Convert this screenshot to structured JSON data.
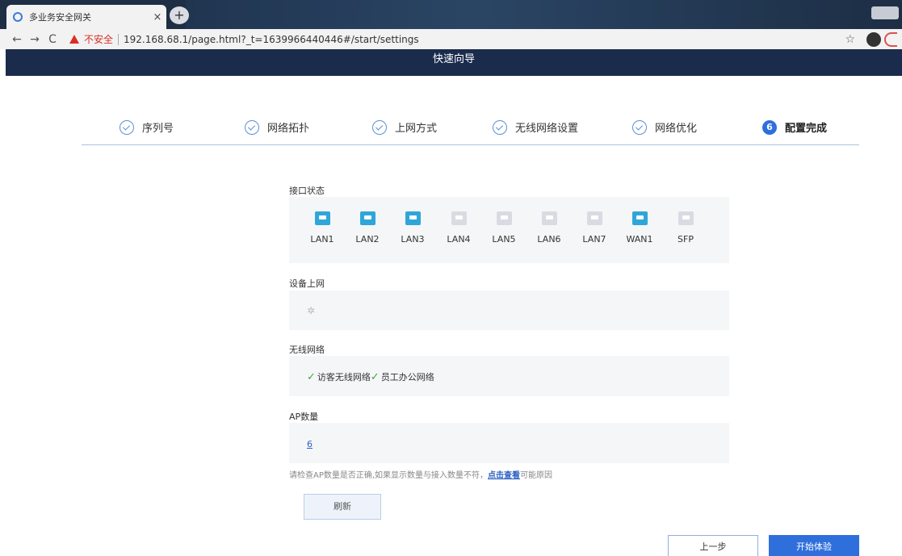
{
  "browser": {
    "tab_title": "多业务安全网关",
    "tab_close": "×",
    "new_tab": "+",
    "security_warning": "不安全",
    "url": "192.168.68.1/page.html?_t=1639966440446#/start/settings"
  },
  "header": {
    "title": "快速向导"
  },
  "steps": [
    {
      "label": "序列号",
      "state": "done"
    },
    {
      "label": "网络拓扑",
      "state": "done"
    },
    {
      "label": "上网方式",
      "state": "done"
    },
    {
      "label": "无线网络设置",
      "state": "done"
    },
    {
      "label": "网络优化",
      "state": "done"
    },
    {
      "label": "配置完成",
      "state": "active",
      "number": "6"
    }
  ],
  "interface_status": {
    "label": "接口状态",
    "ports": [
      {
        "name": "LAN1",
        "active": true
      },
      {
        "name": "LAN2",
        "active": true
      },
      {
        "name": "LAN3",
        "active": true
      },
      {
        "name": "LAN4",
        "active": false
      },
      {
        "name": "LAN5",
        "active": false
      },
      {
        "name": "LAN6",
        "active": false
      },
      {
        "name": "LAN7",
        "active": false
      },
      {
        "name": "WAN1",
        "active": true
      },
      {
        "name": "SFP",
        "active": false
      }
    ]
  },
  "device_online": {
    "label": "设备上网"
  },
  "wireless": {
    "label": "无线网络",
    "networks": [
      "访客无线网络",
      "员工办公网络"
    ]
  },
  "ap": {
    "label": "AP数量",
    "count": "6"
  },
  "hint": {
    "text": "请检查AP数量是否正确,如果显示数量与接入数量不符，",
    "link": "点击查看",
    "suffix": "可能原因"
  },
  "buttons": {
    "refresh": "刷新",
    "prev": "上一步",
    "start": "开始体验"
  },
  "colors": {
    "header_bg": "#1a2b4c",
    "primary": "#2f6fdc",
    "port_on": "#2fa6d8",
    "port_off": "#d8dce2",
    "check_green": "#3aaa35"
  }
}
